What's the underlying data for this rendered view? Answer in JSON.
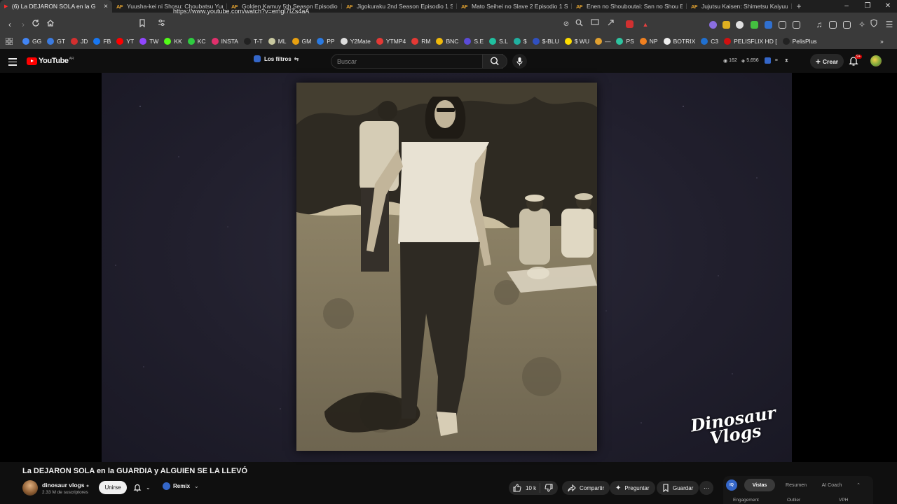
{
  "browser": {
    "tabs": [
      {
        "favicon": "▶",
        "label": "(6) La DEJARON SOLA en la G",
        "active": true
      },
      {
        "favicon": "AF",
        "label": "Yuusha-kei ni Shosu: Choubatsu Yuu"
      },
      {
        "favicon": "AF",
        "label": "Golden Kamuy 5th Season Episodio"
      },
      {
        "favicon": "AF",
        "label": "Jigokuraku 2nd Season Episodio 1 S"
      },
      {
        "favicon": "AF",
        "label": "Mato Seihei no Slave 2 Episodio 1 S"
      },
      {
        "favicon": "AF",
        "label": "Enen no Shouboutai: San no Shou Ep"
      },
      {
        "favicon": "AF",
        "label": "Jujutsu Kaisen: Shimetsu Kaiyuu - Ze"
      }
    ],
    "new_tab": "+",
    "window_controls": [
      "–",
      "❐",
      "✕"
    ],
    "url": "https://www.youtube.com/watch?v=emgI7IZs4aA",
    "bookmarks": [
      {
        "label": "GG",
        "color": "#4285f4"
      },
      {
        "label": "GT",
        "color": "#3b7be0"
      },
      {
        "label": "JD",
        "color": "#d32f2f"
      },
      {
        "label": "FB",
        "color": "#1877f2"
      },
      {
        "label": "YT",
        "color": "#ff0000"
      },
      {
        "label": "TW",
        "color": "#9146ff"
      },
      {
        "label": "KK",
        "color": "#53fc18"
      },
      {
        "label": "KC",
        "color": "#2ecc40"
      },
      {
        "label": "INSTA",
        "color": "#e1306c"
      },
      {
        "label": "T-T",
        "color": "#222222"
      },
      {
        "label": "ML",
        "color": "#c8c8a0"
      },
      {
        "label": "GM",
        "color": "#e8a010"
      },
      {
        "label": "PP",
        "color": "#2a7ae2"
      },
      {
        "label": "Y2Mate",
        "color": "#dddddd"
      },
      {
        "label": "YTMP4",
        "color": "#e53935"
      },
      {
        "label": "RM",
        "color": "#e53935"
      },
      {
        "label": "BNC",
        "color": "#f0b90b"
      },
      {
        "label": "S.E",
        "color": "#5b4bd8"
      },
      {
        "label": "S.L",
        "color": "#20c0a0"
      },
      {
        "label": "$",
        "color": "#20b0a0"
      },
      {
        "label": "$-BLU",
        "color": "#3050c0"
      },
      {
        "label": "$ WU",
        "color": "#ffdd00"
      },
      {
        "label": "—",
        "color": "#e0a030"
      },
      {
        "label": "PS",
        "color": "#2ec4a0"
      },
      {
        "label": "NP",
        "color": "#f08020"
      },
      {
        "label": "BOTRIX",
        "color": "#eeeeee"
      },
      {
        "label": "C3",
        "color": "#2070d0"
      },
      {
        "label": "PELISFLIX HD [",
        "color": "#d01010"
      },
      {
        "label": "PelisPlus",
        "color": "#222222"
      }
    ]
  },
  "youtube": {
    "logo_text": "YouTube",
    "logo_region": "AR",
    "filters_label": "Los filtros",
    "search_placeholder": "Buscar",
    "stats": {
      "views": "162",
      "count": "5,656"
    },
    "create_label": "Crear",
    "notifications": "9+",
    "video": {
      "title": "La DEJARON SOLA en la GUARDIA y ALGUIEN SE LA LLEVÓ",
      "watermark_line1": "Dinosaur",
      "watermark_line2": "Vlogs"
    },
    "channel": {
      "name": "dinosaur vlogs",
      "subscribers": "2.33 M de suscriptores",
      "join_label": "Unirse"
    },
    "remix_label": "Remix",
    "actions": {
      "likes": "10 k",
      "share": "Compartir",
      "ask": "Preguntar",
      "save": "Guardar"
    },
    "panel": {
      "logo": "IQ",
      "tabs": [
        "Vistas",
        "Resumen",
        "AI Coach"
      ],
      "footer": [
        "Engagement",
        "Outlier",
        "VPH"
      ]
    }
  }
}
